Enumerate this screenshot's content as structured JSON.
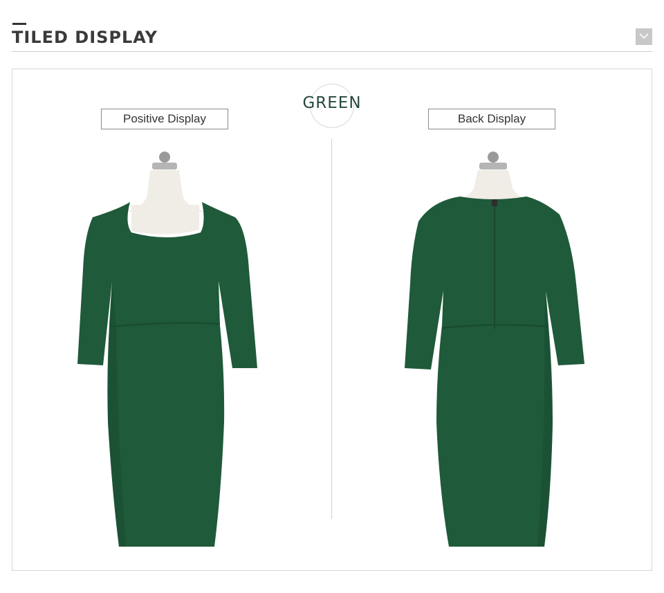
{
  "section": {
    "title": "TILED DISPLAY",
    "collapse_icon": "chevron-down-icon"
  },
  "color_swatch": {
    "name": "GREEN",
    "hex": "#1f5a3a"
  },
  "views": {
    "front_label": "Positive Display",
    "back_label": "Back Display"
  },
  "colors": {
    "dress": "#1f5a3a",
    "dress_shadow": "#184a2f",
    "mannequin": "#f0ece6",
    "title_text": "#3a3a3a",
    "color_text": "#254a3c"
  }
}
